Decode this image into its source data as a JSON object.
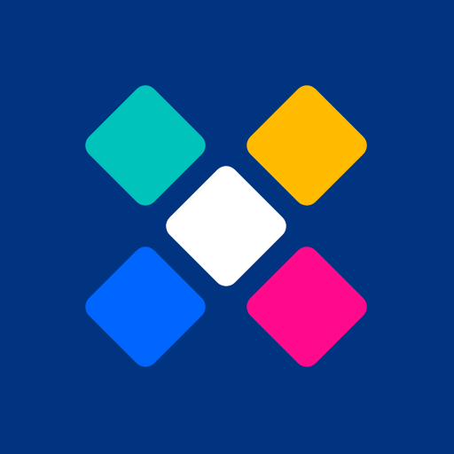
{
  "icon": {
    "colors": {
      "background": "#003380",
      "top_left_tile": "#00C4BC",
      "top_right_tile": "#FFBB00",
      "center_tile": "#FFFFFF",
      "bottom_left_tile": "#0066FF",
      "bottom_right_tile": "#FF0A8C"
    }
  }
}
